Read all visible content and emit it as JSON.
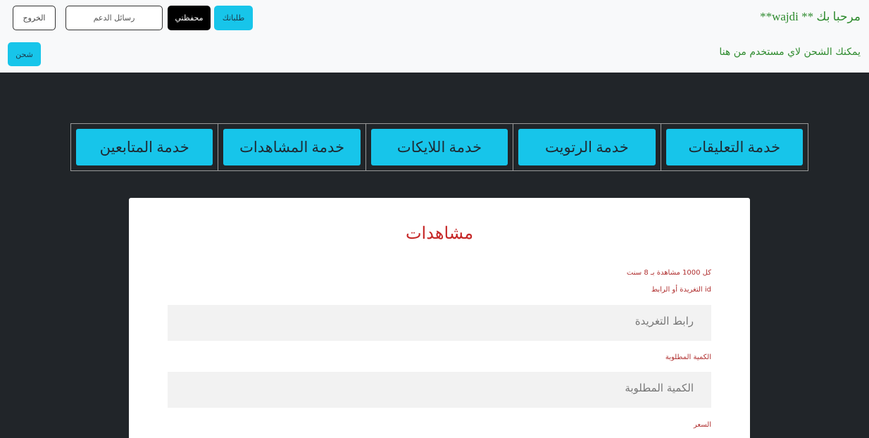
{
  "header": {
    "welcome": "مرحبا بك ** wajdi**",
    "recharge_note": "يمكنك الشحن لاي مستخدم من هنا"
  },
  "nav": {
    "orders_label": "طلباتك",
    "wallet_label": "محفظتي",
    "support_label": "رسائل الدعم",
    "logout_label": "الخروج",
    "recharge_label": "شحن"
  },
  "services": [
    {
      "label": "خدمة التعليقات"
    },
    {
      "label": "خدمة الرتويت"
    },
    {
      "label": "خدمة اللايكات"
    },
    {
      "label": "خدمة المشاهدات"
    },
    {
      "label": "خدمة المتابعين"
    }
  ],
  "form": {
    "title": "مشاهدات",
    "rate_text": "كل 1000 مشاهدة بـ 8 سنت",
    "id_label": "id التغريدة أو الرابط",
    "tweet_placeholder": "رابط التغريدة",
    "quantity_label": "الكمية المطلوبة",
    "quantity_placeholder": "الكمية المطلوبة",
    "price_label": "السعر"
  },
  "colors": {
    "accent": "#17c5ea",
    "success_text": "#2e8b2e",
    "title_red": "#c62828",
    "dark_bg": "#212529"
  }
}
